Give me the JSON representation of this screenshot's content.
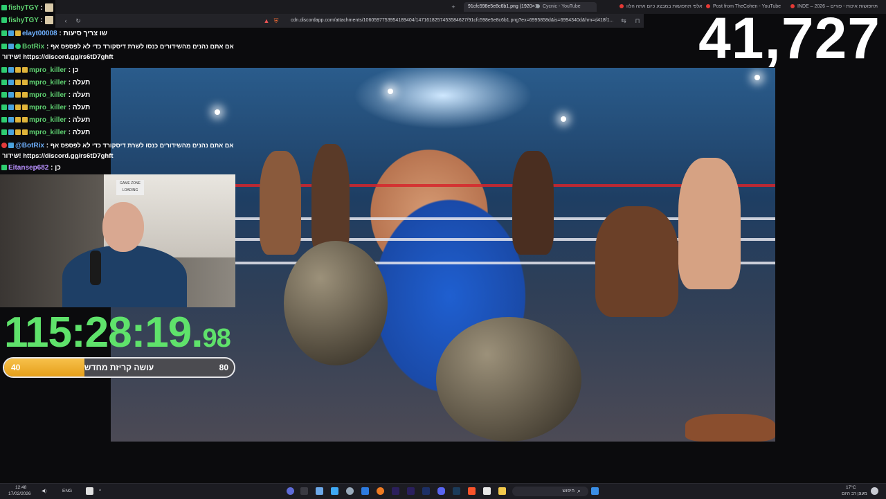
{
  "browser": {
    "tabs": [
      {
        "label": "91cfc598e5e8c6b1.png (1920×1",
        "active": true
      },
      {
        "label": "Cycnic - YouTube",
        "active": false
      },
      {
        "label": "אלפי תחפושות במבצע כיום אתה הלוו",
        "active": false
      },
      {
        "label": "Post from TheCohen - YouTube",
        "active": false
      },
      {
        "label": "INDE – 2026 – תחפושות איכות - פורים",
        "active": false
      }
    ],
    "address": "cdn.discordapp.com/attachments/1060597753954189404/1471618257453584627/91cfc598e5e8c6b1.png?ex=6995858d&is=6994340d&hm=d418f1..."
  },
  "counter": "41,727",
  "chat": {
    "lines": [
      {
        "user": "fishyTGY",
        "sep": " :",
        "msg": "",
        "color": "green"
      },
      {
        "user": "fishyTGY",
        "sep": " :",
        "msg": "",
        "color": "green"
      },
      {
        "user": "elayt00008",
        "sep": " : ",
        "msg": "שו צריך סיעות",
        "color": "blue"
      },
      {
        "user": "BotRix",
        "sep": " : ",
        "msg": "אם אתם נהנים מהשידורים כנסו לשרת דיסקורד כדי לא לפספס אף",
        "color": "green"
      },
      {
        "user": "mpro_killer",
        "sep": " : ",
        "msg": "כן",
        "color": "green"
      },
      {
        "user": "mpro_killer",
        "sep": " : ",
        "msg": "תעלה",
        "color": "green"
      },
      {
        "user": "mpro_killer",
        "sep": " : ",
        "msg": "תעלה",
        "color": "green"
      },
      {
        "user": "mpro_killer",
        "sep": " : ",
        "msg": "תעלה",
        "color": "green"
      },
      {
        "user": "mpro_killer",
        "sep": " : ",
        "msg": "תעלה",
        "color": "green"
      },
      {
        "user": "mpro_killer",
        "sep": " : ",
        "msg": "תעלה",
        "color": "green"
      },
      {
        "user": "@BotRix",
        "sep": " : ",
        "msg": "אם אתם נהנים מהשידורים כנסו לשרת דיסקורד כדי לא לפספס אף",
        "color": "blue"
      },
      {
        "user": "Eitansep682",
        "sep": " : ",
        "msg": "כן",
        "color": "purple"
      }
    ],
    "continuation_1": "שידור! https://discord.gg/rs6tD7ghft",
    "continuation_2": "שידור! https://discord.gg/rs6tD7ghft"
  },
  "webcam": {
    "sign_line1": "GAME ZONE",
    "sign_line2": "LOADING"
  },
  "timer": {
    "main": "115:28:19.",
    "frac": "98"
  },
  "progress": {
    "low": "40",
    "high": "80",
    "label": "עושה קריזת מחדש",
    "fraction": 0.35
  },
  "taskbar": {
    "time": "12:48",
    "date": "17/02/2026",
    "lang": "ENG",
    "search": "חיפוש",
    "weather_temp": "17°C",
    "weather_desc": "מעונן רב היום"
  }
}
